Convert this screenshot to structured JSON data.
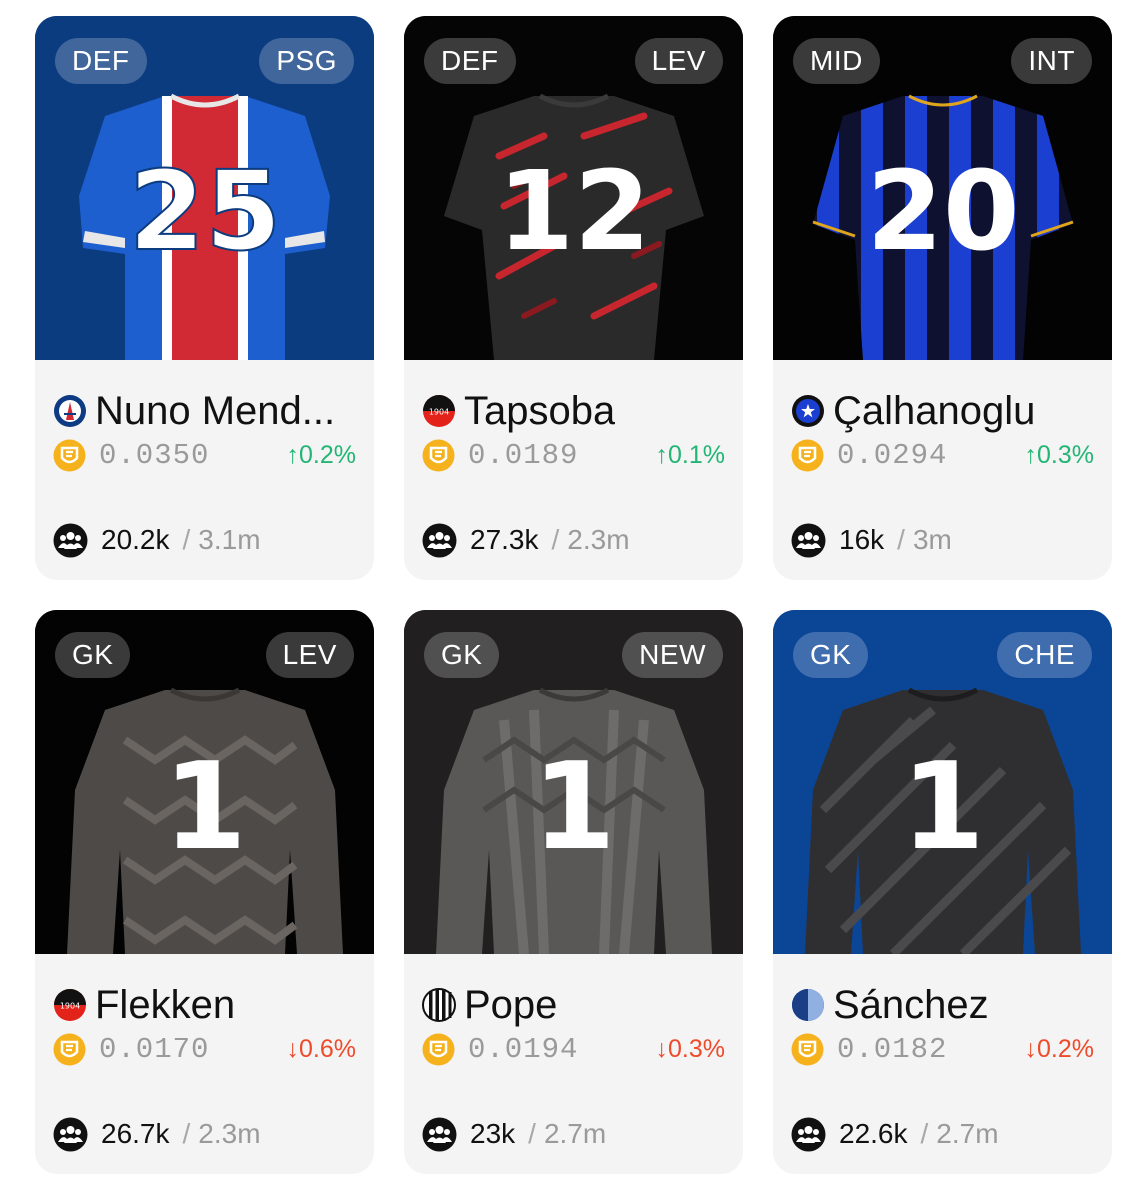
{
  "colors": {
    "up": "#22b573",
    "down": "#ee4b2b",
    "coin": "#f5b21c",
    "card_bg": "#f4f4f5"
  },
  "cards": [
    {
      "position": "DEF",
      "club": "PSG",
      "name": "Nuno Mend...",
      "price": "0.0350",
      "change": "0.2%",
      "direction": "up",
      "fans": "20.2k",
      "total": "3.1m",
      "hero_bg": "#0b3c7f",
      "shirt_number": "25",
      "club_logo_icon": "psg-eiffel-logo-icon",
      "jersey": "psg-home-jersey"
    },
    {
      "position": "DEF",
      "club": "LEV",
      "name": "Tapsoba",
      "price": "0.0189",
      "change": "0.1%",
      "direction": "up",
      "fans": "27.3k",
      "total": "2.3m",
      "hero_bg": "#050505",
      "shirt_number": "12",
      "club_logo_icon": "leverkusen-1904-logo-icon",
      "logo_text": "1904",
      "jersey": "leverkusen-dark-jersey"
    },
    {
      "position": "MID",
      "club": "INT",
      "name": "Çalhanoglu",
      "price": "0.0294",
      "change": "0.3%",
      "direction": "up",
      "fans": "16k",
      "total": "3m",
      "hero_bg": "#030303",
      "shirt_number": "20",
      "club_logo_icon": "inter-star-logo-icon",
      "jersey": "inter-striped-jersey"
    },
    {
      "position": "GK",
      "club": "LEV",
      "name": "Flekken",
      "price": "0.0170",
      "change": "0.6%",
      "direction": "down",
      "fans": "26.7k",
      "total": "2.3m",
      "hero_bg": "#030303",
      "shirt_number": "1",
      "club_logo_icon": "leverkusen-1904-logo-icon",
      "logo_text": "1904",
      "jersey": "goalkeeper-grey-jersey"
    },
    {
      "position": "GK",
      "club": "NEW",
      "name": "Pope",
      "price": "0.0194",
      "change": "0.3%",
      "direction": "down",
      "fans": "23k",
      "total": "2.7m",
      "hero_bg": "#211f1f",
      "shirt_number": "1",
      "club_logo_icon": "newcastle-stripes-logo-icon",
      "jersey": "goalkeeper-grey-jersey"
    },
    {
      "position": "GK",
      "club": "CHE",
      "name": "Sánchez",
      "price": "0.0182",
      "change": "0.2%",
      "direction": "down",
      "fans": "22.6k",
      "total": "2.7m",
      "hero_bg": "#0b4596",
      "shirt_number": "1",
      "club_logo_icon": "chelsea-half-moon-logo-icon",
      "jersey": "goalkeeper-dark-jersey"
    }
  ]
}
